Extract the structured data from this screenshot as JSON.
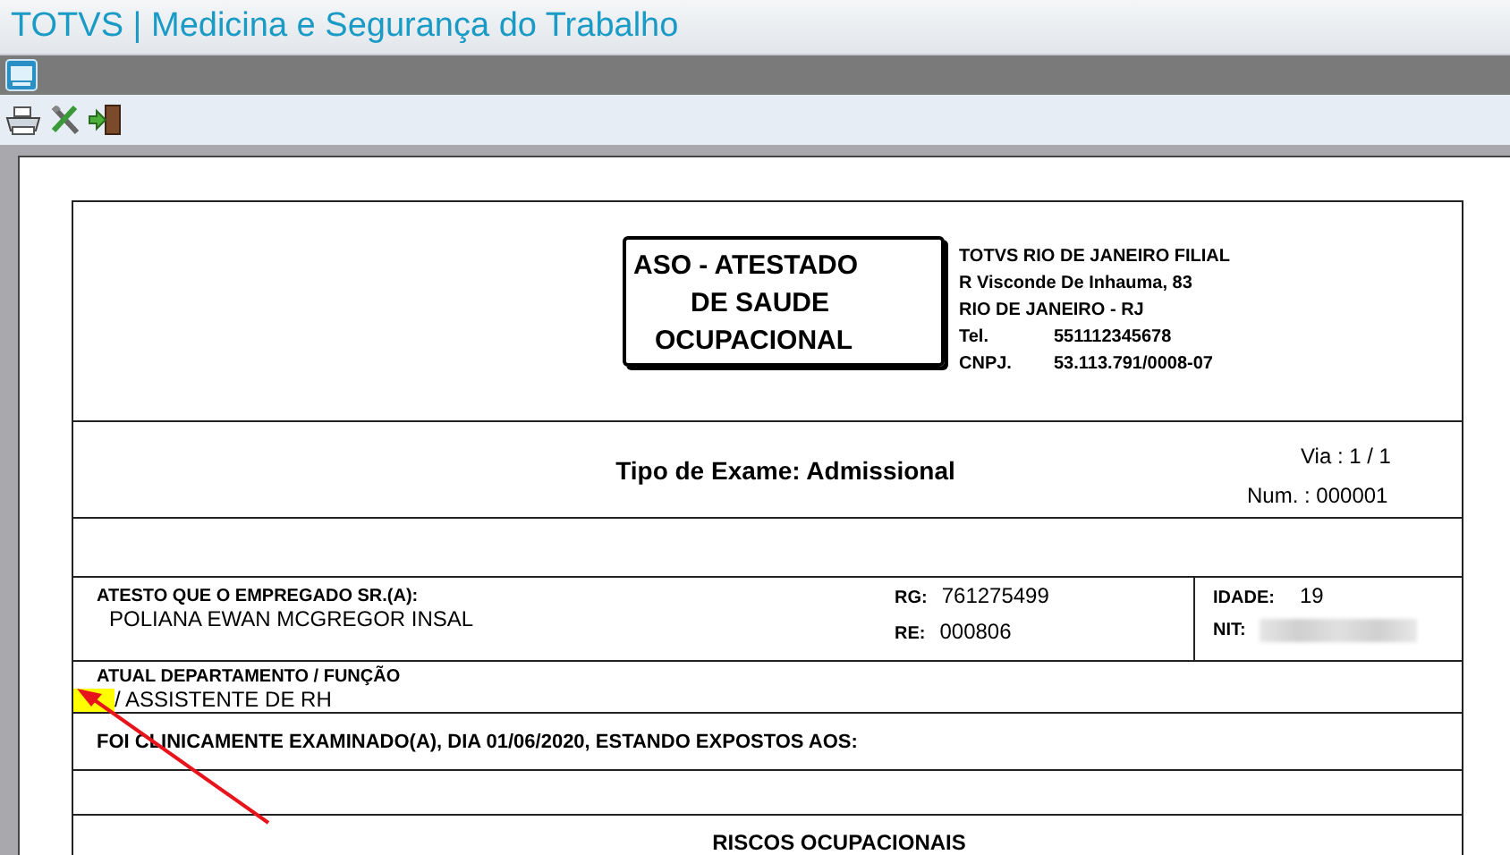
{
  "window": {
    "title": "TOTVS | Medicina e Segurança do Trabalho"
  },
  "toolbar": {
    "buttons": [
      {
        "kind": "printer"
      },
      {
        "kind": "tools"
      },
      {
        "kind": "exit"
      }
    ]
  },
  "document": {
    "title_lines": [
      "ASO - ATESTADO",
      "DE SAUDE",
      "OCUPACIONAL"
    ],
    "company": [
      {
        "label": "TOTVS RIO DE JANEIRO FILIAL"
      },
      {
        "label": "R Visconde De Inhauma, 83"
      },
      {
        "label": "RIO DE JANEIRO - RJ"
      },
      {
        "label": "Tel.",
        "value": "551112345678"
      },
      {
        "label": "CNPJ.",
        "value": "53.113.791/0008-07"
      }
    ],
    "exam_type": "Tipo de Exame: Admissional",
    "via": "Via :  1 / 1",
    "num": "Num. : 000001",
    "employee_label": "ATESTO QUE O EMPREGADO SR.(A):",
    "employee_name": "POLIANA EWAN MCGREGOR INSAL",
    "rg_label": "RG:",
    "rg": "761275499",
    "re_label": "RE:",
    "re": "000806",
    "age_label": "IDADE:",
    "age": "19",
    "nit_label": "NIT:",
    "department_label": "ATUAL DEPARTAMENTO / FUNÇÃO",
    "department_value": "/ ASSISTENTE DE RH",
    "examined": "FOI CLINICAMENTE EXAMINADO(A), DIA 01/06/2020,  ESTANDO EXPOSTOS AOS:",
    "risks_title": "RISCOS OCUPACIONAIS"
  }
}
